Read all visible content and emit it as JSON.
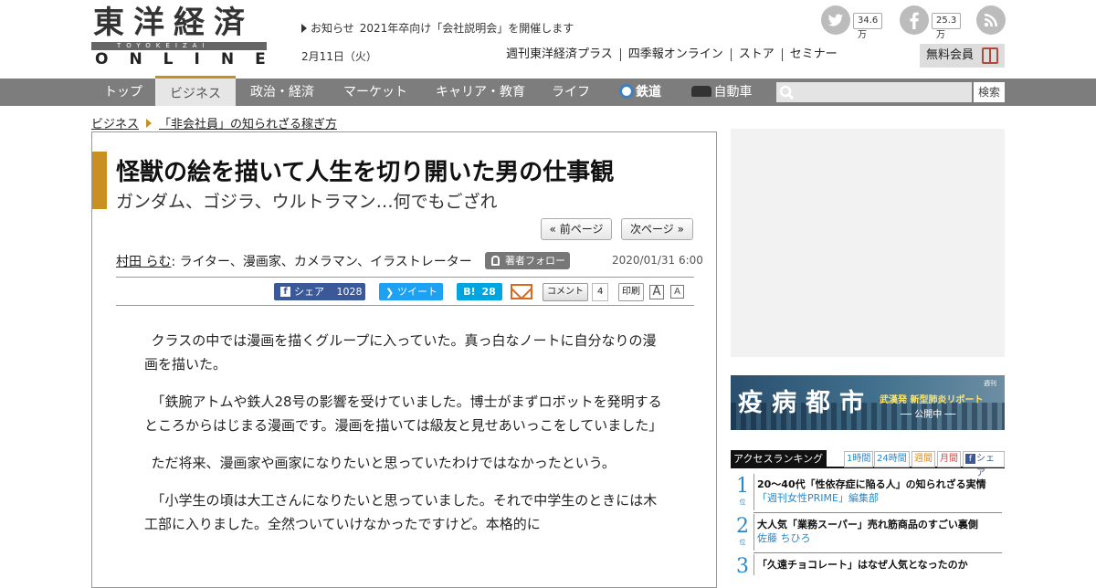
{
  "header": {
    "logo_kanji": "東洋経済",
    "logo_sub": "TOYOKEIZAI",
    "logo_online": "ONLINE",
    "notice_label": "お知らせ",
    "notice_title": "2021年卒向け「会社説明会」を開催します",
    "date": "2月11日（火）",
    "social": {
      "twitter_count": "34.6万",
      "facebook_count": "25.3万"
    },
    "links": [
      "週刊東洋経済プラス",
      "四季報オンライン",
      "ストア",
      "セミナー"
    ],
    "member_label": "無料会員"
  },
  "nav": {
    "items": [
      "トップ",
      "ビジネス",
      "政治・経済",
      "マーケット",
      "キャリア・教育",
      "ライフ",
      "鉄道",
      "自動車"
    ],
    "active_index": 1,
    "search_button": "検索"
  },
  "breadcrumb": {
    "section": "ビジネス",
    "series": "「非会社員」の知られざる稼ぎ方"
  },
  "article": {
    "headline": "怪獣の絵を描いて人生を切り開いた男の仕事観",
    "subhead": "ガンダム、ゴジラ、ウルトラマン…何でもござれ",
    "prev_page": "« 前ページ",
    "next_page": "次ページ »",
    "author_name": "村田 らむ",
    "author_role": ": ライター、漫画家、カメラマン、イラストレーター",
    "follow_label": "著者フォロー",
    "pub_date": "2020/01/31 6:00",
    "share": {
      "fb_label": "シェア",
      "fb_count": "1028",
      "tw_label": "ツイート",
      "hb_label": "B!",
      "hb_count": "28",
      "comment_label": "コメント",
      "comment_count": "4",
      "print_label": "印刷",
      "font_large": "A",
      "font_small": "A"
    },
    "paragraphs": [
      "クラスの中では漫画を描くグループに入っていた。真っ白なノートに自分なりの漫画を描いた。",
      "「鉄腕アトムや鉄人28号の影響を受けていました。博士がまずロボットを発明するところからはじまる漫画です。漫画を描いては級友と見せあいっこをしていました」",
      "ただ将来、漫画家や画家になりたいと思っていたわけではなかったという。",
      "「小学生の頃は大工さんになりたいと思っていました。それで中学生のときには木工部に入りました。全然ついていけなかったですけど。本格的に"
    ]
  },
  "sidebar": {
    "banner": {
      "title": "疫病都市",
      "subtitle": "武漢発 新型肺炎リポート",
      "status": "── 公開中 ──",
      "publisher": "週刊"
    },
    "ranking": {
      "title": "アクセスランキング",
      "tabs": [
        "1時間",
        "24時間",
        "週間",
        "月間",
        "シェア"
      ],
      "rank_suffix": "位",
      "items": [
        {
          "rank": "1",
          "title": "20～40代「性依存症に陥る人」の知られざる実情",
          "author": "「週刊女性PRIME」編集部"
        },
        {
          "rank": "2",
          "title": "大人気「業務スーパー」売れ筋商品のすごい裏側",
          "author": "佐藤 ちひろ"
        },
        {
          "rank": "3",
          "title": "「久遠チョコレート」はなぜ人気となったのか",
          "author": ""
        }
      ]
    }
  },
  "colors": {
    "nav_bg": "#7d7d7d",
    "accent": "#c98f21",
    "link_blue": "#2a88c9",
    "facebook": "#3b5998",
    "twitter": "#1da1f2",
    "hatena": "#00a4de"
  }
}
